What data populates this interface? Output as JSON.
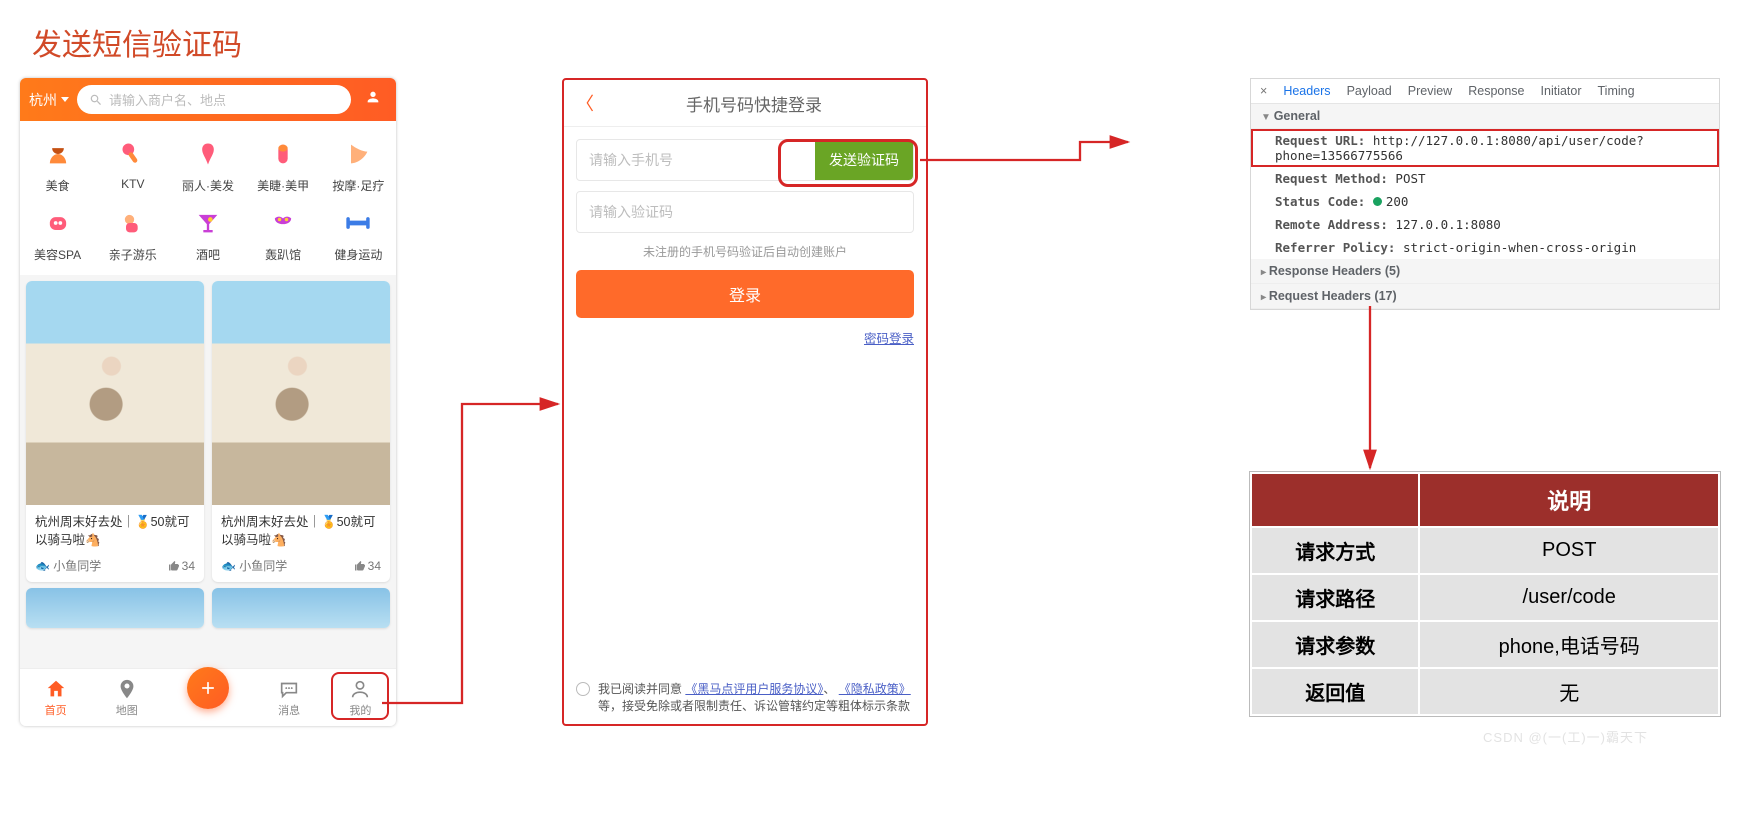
{
  "page_title": "发送短信验证码",
  "app": {
    "city": "杭州",
    "search_placeholder": "请输入商户名、地点",
    "categories": [
      {
        "label": "美食"
      },
      {
        "label": "KTV"
      },
      {
        "label": "丽人·美发"
      },
      {
        "label": "美睫·美甲"
      },
      {
        "label": "按摩·足疗"
      },
      {
        "label": "美容SPA"
      },
      {
        "label": "亲子游乐"
      },
      {
        "label": "酒吧"
      },
      {
        "label": "轰趴馆"
      },
      {
        "label": "健身运动"
      }
    ],
    "card": {
      "title": "杭州周末好去处｜🏅50就可以骑马啦🐴",
      "author": "小鱼同学",
      "likes": "34"
    },
    "tabs": {
      "home": "首页",
      "map": "地图",
      "msg": "消息",
      "mine": "我的"
    }
  },
  "login": {
    "title": "手机号码快捷登录",
    "phone_placeholder": "请输入手机号",
    "code_placeholder": "请输入验证码",
    "send_btn": "发送验证码",
    "note": "未注册的手机号码验证后自动创建账户",
    "login_btn": "登录",
    "pwd_link": "密码登录",
    "agree_prefix": "我已阅读并同意",
    "agree_link1": "《黑马点评用户服务协议》",
    "agree_sep": "、",
    "agree_link2": "《隐私政策》",
    "agree_suffix": "等，接受免除或者限制责任、诉讼管辖约定等粗体标示条款"
  },
  "devtools": {
    "tabs": {
      "headers": "Headers",
      "payload": "Payload",
      "preview": "Preview",
      "response": "Response",
      "initiator": "Initiator",
      "timing": "Timing"
    },
    "general": "General",
    "req_url_k": "Request URL:",
    "req_url_v": "http://127.0.0.1:8080/api/user/code?phone=13566775566",
    "req_method_k": "Request Method:",
    "req_method_v": "POST",
    "status_k": "Status Code:",
    "status_v": "200",
    "remote_k": "Remote Address:",
    "remote_v": "127.0.0.1:8080",
    "refpol_k": "Referrer Policy:",
    "refpol_v": "strict-origin-when-cross-origin",
    "resp_hdr": "Response Headers (5)",
    "req_hdr": "Request Headers (17)"
  },
  "spec": {
    "header_1": "",
    "header_2": "说明",
    "rows": [
      {
        "k": "请求方式",
        "v": "POST"
      },
      {
        "k": "请求路径",
        "v": "/user/code"
      },
      {
        "k": "请求参数",
        "v": "phone,电话号码"
      },
      {
        "k": "返回值",
        "v": "无"
      }
    ]
  },
  "watermark": "CSDN @(一(工)一)霸天下"
}
